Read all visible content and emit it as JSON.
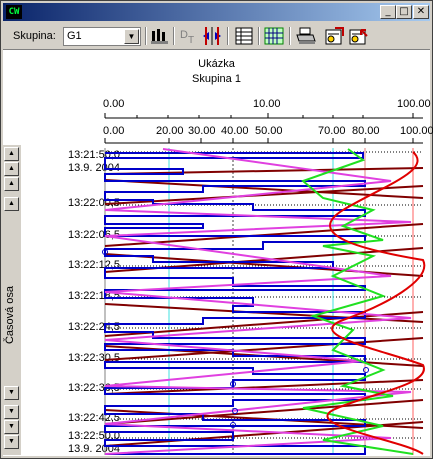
{
  "window": {
    "title": "",
    "app_icon_text": "CW"
  },
  "caption_buttons": {
    "minimize": "_",
    "maximize": "□",
    "close": "✕"
  },
  "toolbar": {
    "group_label": "Skupina:",
    "group_value": "G1",
    "icons": [
      "bar-settings-icon",
      "dt-icon",
      "arrows-icon",
      "table-icon",
      "grid-icon",
      "print-icon",
      "export-icon",
      "import-icon"
    ]
  },
  "plot": {
    "title": "Ukázka",
    "subtitle": "Skupina 1",
    "top_scale": [
      "0.00",
      "10.00",
      "100.00"
    ],
    "second_scale": [
      "0.00",
      "20.00",
      "30.00",
      "40.00",
      "50.00",
      "70.00",
      "80.00",
      "100.00"
    ],
    "axis_title": "Časová osa",
    "time_labels": [
      "13:21:50,0",
      "13.9. 2004",
      "13:22:00,5",
      "13:22:06,5",
      "13:22:12,5",
      "13:22:18,5",
      "13:22:24,5",
      "13:22:30,5",
      "13:22:36,5",
      "13:22:42,5",
      "13:22:50,0",
      "13.9. 2004"
    ]
  },
  "colors": {
    "blue": "#0000c8",
    "darkred": "#800000",
    "red": "#e00000",
    "magenta": "#e040e0",
    "green": "#20e020",
    "cyan": "#40e0e0"
  }
}
